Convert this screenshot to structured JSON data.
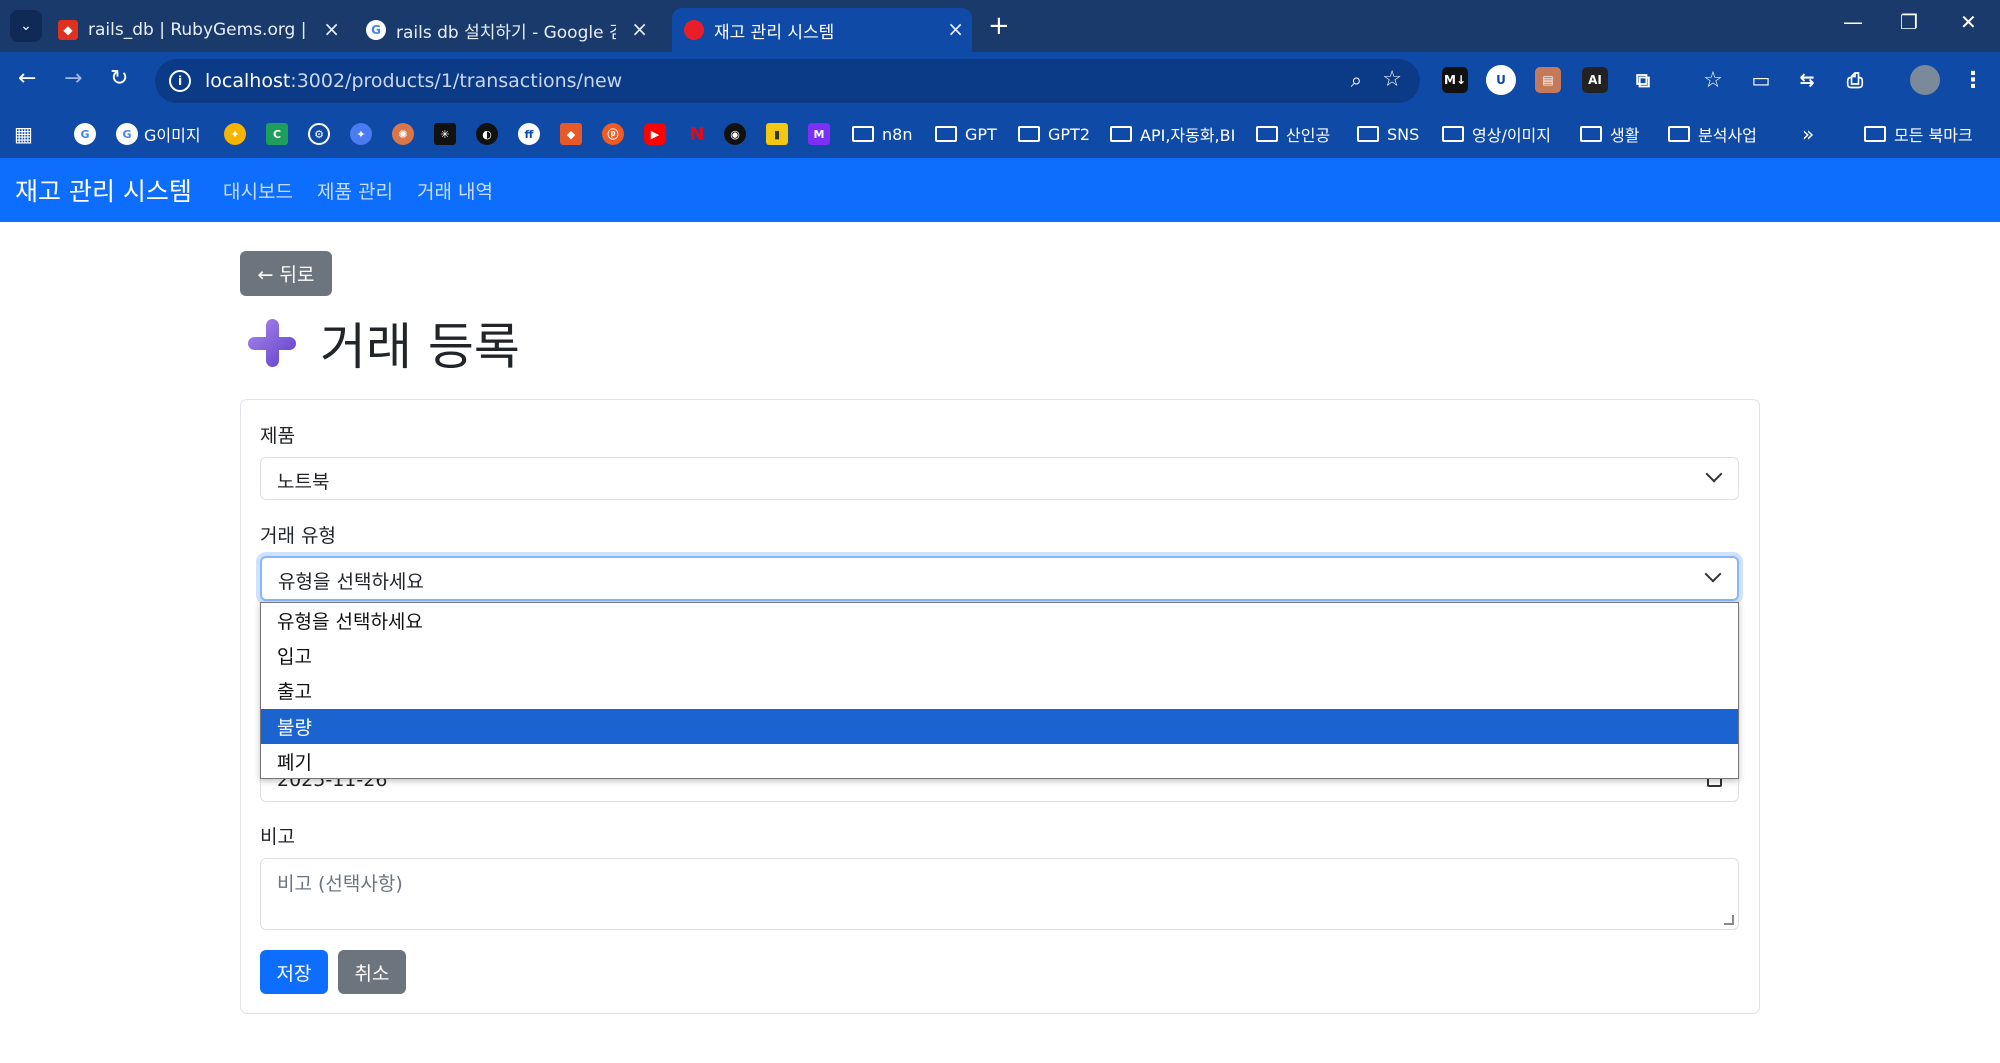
{
  "browser": {
    "tabs": [
      {
        "title": "rails_db | RubyGems.org | your",
        "favicon": "rubygems-icon"
      },
      {
        "title": "rails db 설치하기 - Google 검",
        "favicon": "google-icon"
      },
      {
        "title": "재고 관리 시스템",
        "favicon": "red-dot-icon",
        "active": true
      }
    ],
    "url_host": "localhost",
    "url_path": ":3002/products/1/transactions/new",
    "bookmarks": [
      "G이미지",
      "n8n",
      "GPT",
      "GPT2",
      "API,자동화,BI",
      "산인공",
      "SNS",
      "영상/이미지",
      "생활",
      "분석사업",
      "모든 북마크"
    ],
    "extensions": [
      "M↓",
      "AI"
    ]
  },
  "app": {
    "brand": "재고 관리 시스템",
    "nav": [
      "대시보드",
      "제품 관리",
      "거래 내역"
    ]
  },
  "page": {
    "back_label": "← 뒤로",
    "title": "거래 등록"
  },
  "form": {
    "product_label": "제품",
    "product_value": "노트북",
    "type_label": "거래 유형",
    "type_value": "유형을 선택하세요",
    "type_options": [
      "유형을 선택하세요",
      "입고",
      "출고",
      "불량",
      "폐기"
    ],
    "type_highlighted": "불량",
    "date_value": "2025-11-26",
    "note_label": "비고",
    "note_placeholder": "비고 (선택사항)",
    "save_label": "저장",
    "cancel_label": "취소"
  }
}
